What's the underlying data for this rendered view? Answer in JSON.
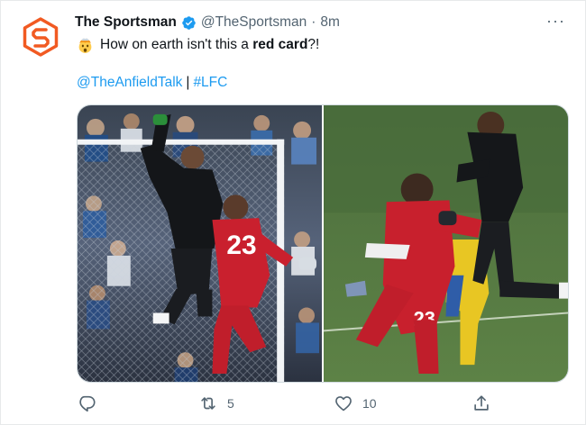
{
  "tweet": {
    "display_name": "The Sportsman",
    "handle": "@TheSportsman",
    "separator": "·",
    "time": "8m",
    "more_label": "···",
    "text_before": "How on earth isn't this a ",
    "text_bold": "red card",
    "text_after": "?!",
    "mention_link": "@TheAnfieldTalk",
    "pipe": "|",
    "hashtag_link": "#LFC",
    "shirt_number": "23",
    "avatar_color": "#f15a22",
    "link_color": "#1d9bf0"
  },
  "actions": {
    "reply_icon": "reply-icon",
    "retweet_icon": "retweet-icon",
    "retweet_count": "5",
    "like_icon": "heart-icon",
    "like_count": "10",
    "share_icon": "share-icon"
  }
}
